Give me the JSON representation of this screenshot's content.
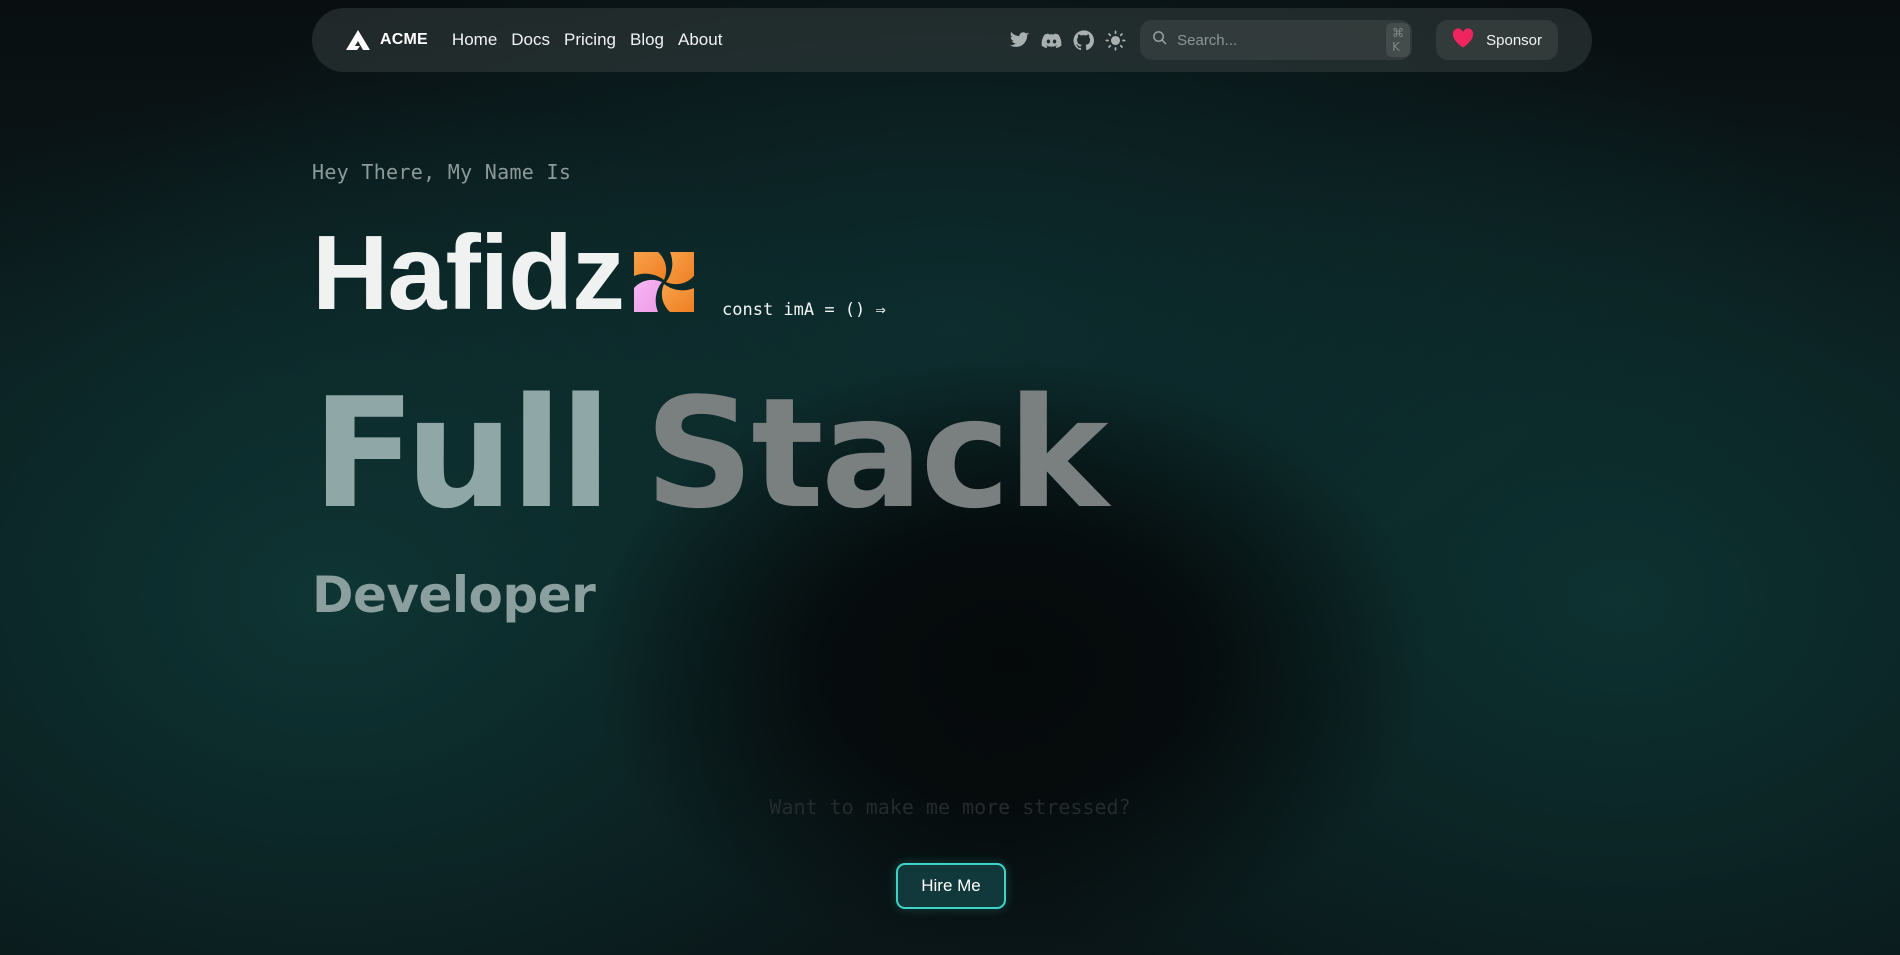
{
  "nav": {
    "brand": "ACME",
    "links": [
      "Home",
      "Docs",
      "Pricing",
      "Blog",
      "About"
    ],
    "icons": [
      "twitter-icon",
      "discord-icon",
      "github-icon",
      "theme-toggle-icon"
    ],
    "search": {
      "placeholder": "Search...",
      "shortcut": "⌘ K"
    },
    "sponsor_label": "Sponsor"
  },
  "hero": {
    "greeting": "Hey There, My Name Is",
    "name": "Hafidz",
    "code": "const imA = () ⇒",
    "title_word_1": "Full",
    "title_word_2": "Stack",
    "subtitle": "Developer",
    "tagline": "Want to make me more stressed?",
    "cta_label": "Hire Me"
  },
  "colors": {
    "accent": "#3fd3c6",
    "sponsor_heart": "#f0245e",
    "pinwheel_orange": "#f59230",
    "pinwheel_pink": "#f5a3f0"
  }
}
